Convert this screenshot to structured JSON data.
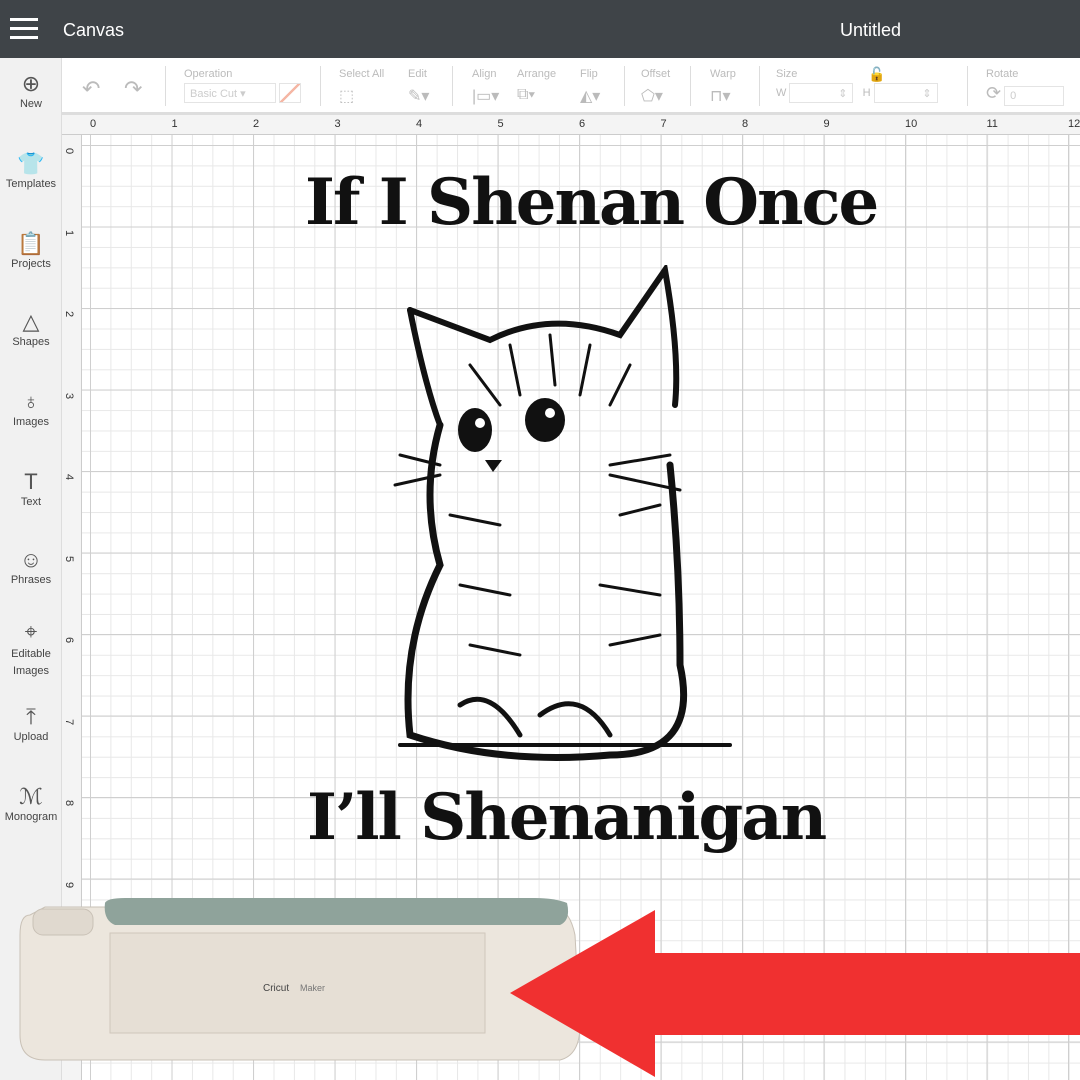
{
  "header": {
    "app_title": "Canvas",
    "document_title": "Untitled"
  },
  "sidebar": {
    "items": [
      {
        "label": "New",
        "icon": "plus-circle-icon"
      },
      {
        "label": "Templates",
        "icon": "shirt-icon"
      },
      {
        "label": "Projects",
        "icon": "clipboard-icon"
      },
      {
        "label": "Shapes",
        "icon": "shapes-icon"
      },
      {
        "label": "Images",
        "icon": "lightbulb-icon"
      },
      {
        "label": "Text",
        "icon": "text-icon"
      },
      {
        "label": "Phrases",
        "icon": "speech-bubble-icon"
      },
      {
        "label": "Editable Images",
        "icon": "editable-image-icon"
      },
      {
        "label": "Upload",
        "icon": "upload-icon"
      },
      {
        "label": "Monogram",
        "icon": "monogram-icon"
      }
    ]
  },
  "toolbar": {
    "operation_label": "Operation",
    "operation_value": "Basic Cut",
    "select_all": "Select All",
    "edit": "Edit",
    "align": "Align",
    "arrange": "Arrange",
    "flip": "Flip",
    "offset": "Offset",
    "warp": "Warp",
    "size": "Size",
    "w": "W",
    "h": "H",
    "rotate": "Rotate",
    "rotate_value": "0"
  },
  "ruler": {
    "top": [
      "0",
      "1",
      "2",
      "3",
      "4",
      "5",
      "6",
      "7",
      "8",
      "9",
      "10",
      "11",
      "12"
    ],
    "left": [
      "0",
      "1",
      "2",
      "3",
      "4",
      "5",
      "6",
      "7",
      "8",
      "9"
    ]
  },
  "design": {
    "line1": "If I Shenan Once",
    "line2": "I’ll Shenanigan"
  },
  "machine": {
    "brand": "Cricut",
    "model": "Maker"
  },
  "colors": {
    "header": "#3f4448",
    "arrow": "#f03030",
    "machine_lid": "#8fa39b"
  }
}
